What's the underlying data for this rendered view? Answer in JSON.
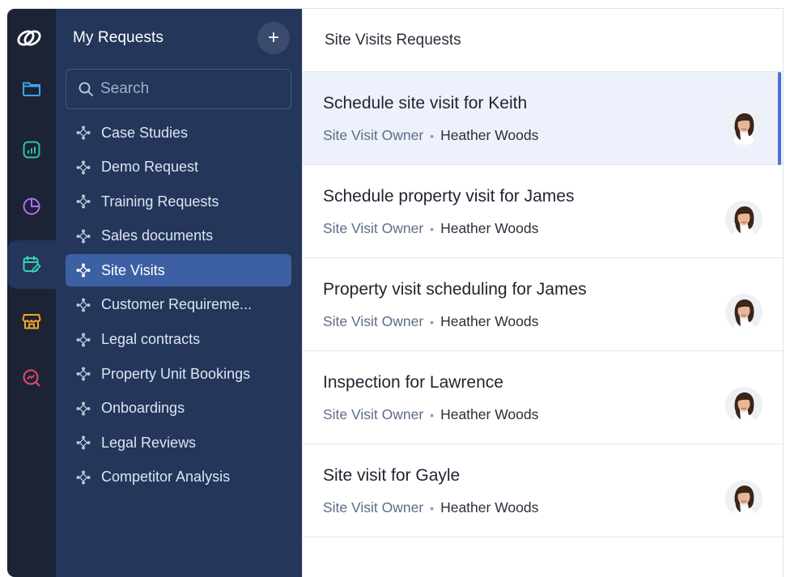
{
  "rail": {
    "icons": [
      "logo-icon",
      "folder-icon",
      "analytics-icon",
      "pie-chart-icon",
      "calendar-edit-icon",
      "store-icon",
      "search-analytics-icon"
    ],
    "colors": {
      "folder": "#3ba7f0",
      "analytics": "#2fc3a0",
      "pie": "#b36cf0",
      "calendar": "#36d3b2",
      "store": "#f5a623",
      "search": "#e8476a"
    }
  },
  "sidebar": {
    "title": "My Requests",
    "add_label": "+",
    "search_placeholder": "Search",
    "items": [
      {
        "label": "Case Studies",
        "active": false
      },
      {
        "label": "Demo Request",
        "active": false
      },
      {
        "label": "Training Requests",
        "active": false
      },
      {
        "label": "Sales documents",
        "active": false
      },
      {
        "label": "Site Visits",
        "active": true
      },
      {
        "label": "Customer Requireme...",
        "active": false
      },
      {
        "label": "Legal contracts",
        "active": false
      },
      {
        "label": "Property Unit Bookings",
        "active": false
      },
      {
        "label": "Onboardings",
        "active": false
      },
      {
        "label": "Legal Reviews",
        "active": false
      },
      {
        "label": "Competitor Analysis",
        "active": false
      }
    ]
  },
  "main": {
    "header": "Site Visits Requests",
    "requests": [
      {
        "title": "Schedule site visit for Keith",
        "owner_label": "Site Visit Owner",
        "owner": "Heather Woods",
        "active": true
      },
      {
        "title": "Schedule property visit for James",
        "owner_label": "Site Visit Owner",
        "owner": "Heather Woods",
        "active": false
      },
      {
        "title": "Property visit scheduling for James",
        "owner_label": "Site Visit Owner",
        "owner": "Heather Woods",
        "active": false
      },
      {
        "title": "Inspection for Lawrence",
        "owner_label": "Site Visit Owner",
        "owner": "Heather Woods",
        "active": false
      },
      {
        "title": "Site visit for Gayle",
        "owner_label": "Site Visit Owner",
        "owner": "Heather Woods",
        "active": false
      }
    ]
  }
}
